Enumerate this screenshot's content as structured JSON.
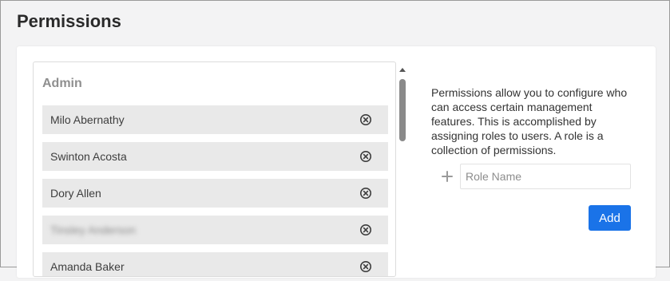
{
  "page": {
    "title": "Permissions"
  },
  "role": {
    "name": "Admin",
    "users": [
      {
        "name": "Milo Abernathy",
        "remove_icon": "circle-x-icon"
      },
      {
        "name": "Swinton Acosta",
        "remove_icon": "circle-x-icon"
      },
      {
        "name": "Dory Allen",
        "remove_icon": "circle-x-icon"
      },
      {
        "name": "Tinsley Anderson",
        "remove_icon": "circle-x-icon",
        "blurred": true
      },
      {
        "name": "Amanda Baker",
        "remove_icon": "circle-x-icon"
      }
    ]
  },
  "info": {
    "description": "Permissions allow you to configure who can access certain management features. This is accomplished by assigning roles to users. A role is a collection of permissions.",
    "add_icon": "plus-icon",
    "role_name_placeholder": "Role Name",
    "role_name_value": "",
    "add_button_label": "Add"
  },
  "colors": {
    "background": "#f3f3f4",
    "card": "#ffffff",
    "row": "#e9e9e9",
    "accent": "#1a73e8"
  }
}
